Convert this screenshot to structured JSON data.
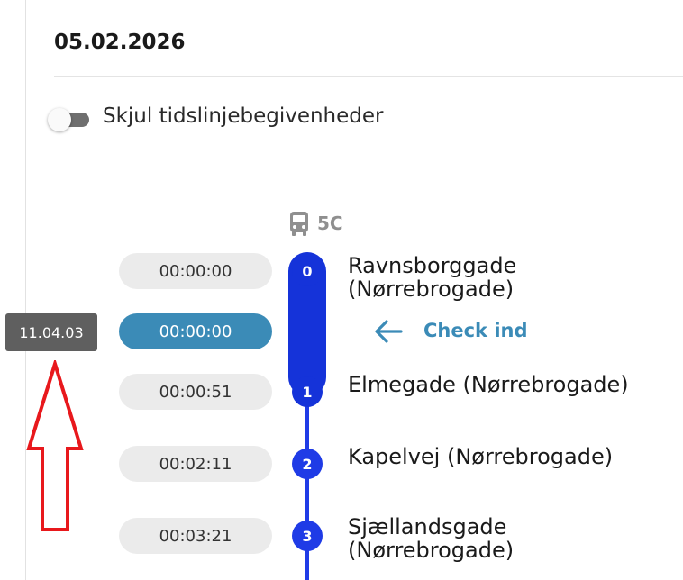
{
  "date_header": "05.02.2026",
  "toggle": {
    "label": "Skjul tidslinjebegivenheder",
    "on": false
  },
  "route": {
    "icon": "bus-icon",
    "name": "5C"
  },
  "clock_badge": "11.04.03",
  "check_in": {
    "icon": "arrow-left-icon",
    "label": "Check ind"
  },
  "stops": [
    {
      "number": "0",
      "time": "00:00:00",
      "name_line1": "Ravnsborggade",
      "name_line2": "(Nørrebrogade)"
    },
    {
      "number": "1",
      "time": "00:00:51",
      "name_line1": "Elmegade (Nørrebrogade)",
      "name_line2": ""
    },
    {
      "number": "2",
      "time": "00:02:11",
      "name_line1": "Kapelvej (Nørrebrogade)",
      "name_line2": ""
    },
    {
      "number": "3",
      "time": "00:03:21",
      "name_line1": "Sjællandsgade",
      "name_line2": "(Nørrebrogade)"
    }
  ],
  "current_time_pill": "00:00:00",
  "colors": {
    "timeline_blue": "#1f3be6",
    "active_segment_blue": "#1533d9",
    "check_in_blue": "#3b8bb7",
    "pill_grey": "#ebebeb",
    "badge_grey": "#5f5f5f",
    "annotation_red": "#e8181c"
  }
}
